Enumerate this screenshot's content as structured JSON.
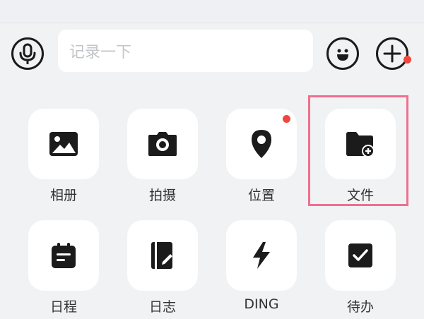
{
  "input_bar": {
    "placeholder": "记录一下",
    "mic_icon": "microphone-icon",
    "emoji_icon": "smiley-face-icon",
    "add_icon": "plus-circle-icon",
    "add_has_badge": true
  },
  "grid": [
    {
      "label": "相册",
      "icon": "image-gallery-icon",
      "badge": false
    },
    {
      "label": "拍摄",
      "icon": "camera-icon",
      "badge": false
    },
    {
      "label": "位置",
      "icon": "location-pin-icon",
      "badge": true
    },
    {
      "label": "文件",
      "icon": "folder-add-icon",
      "badge": false,
      "highlighted": true
    },
    {
      "label": "日程",
      "icon": "calendar-icon",
      "badge": false
    },
    {
      "label": "日志",
      "icon": "journal-edit-icon",
      "badge": false
    },
    {
      "label": "DING",
      "icon": "lightning-bolt-icon",
      "badge": false
    },
    {
      "label": "待办",
      "icon": "checkbox-icon",
      "badge": false
    }
  ],
  "colors": {
    "background": "#f0f2f4",
    "tile": "#ffffff",
    "icon": "#1b1b1b",
    "badge": "#f1453d",
    "highlight_border": "#ef6f90",
    "placeholder": "#c3c5c9"
  }
}
